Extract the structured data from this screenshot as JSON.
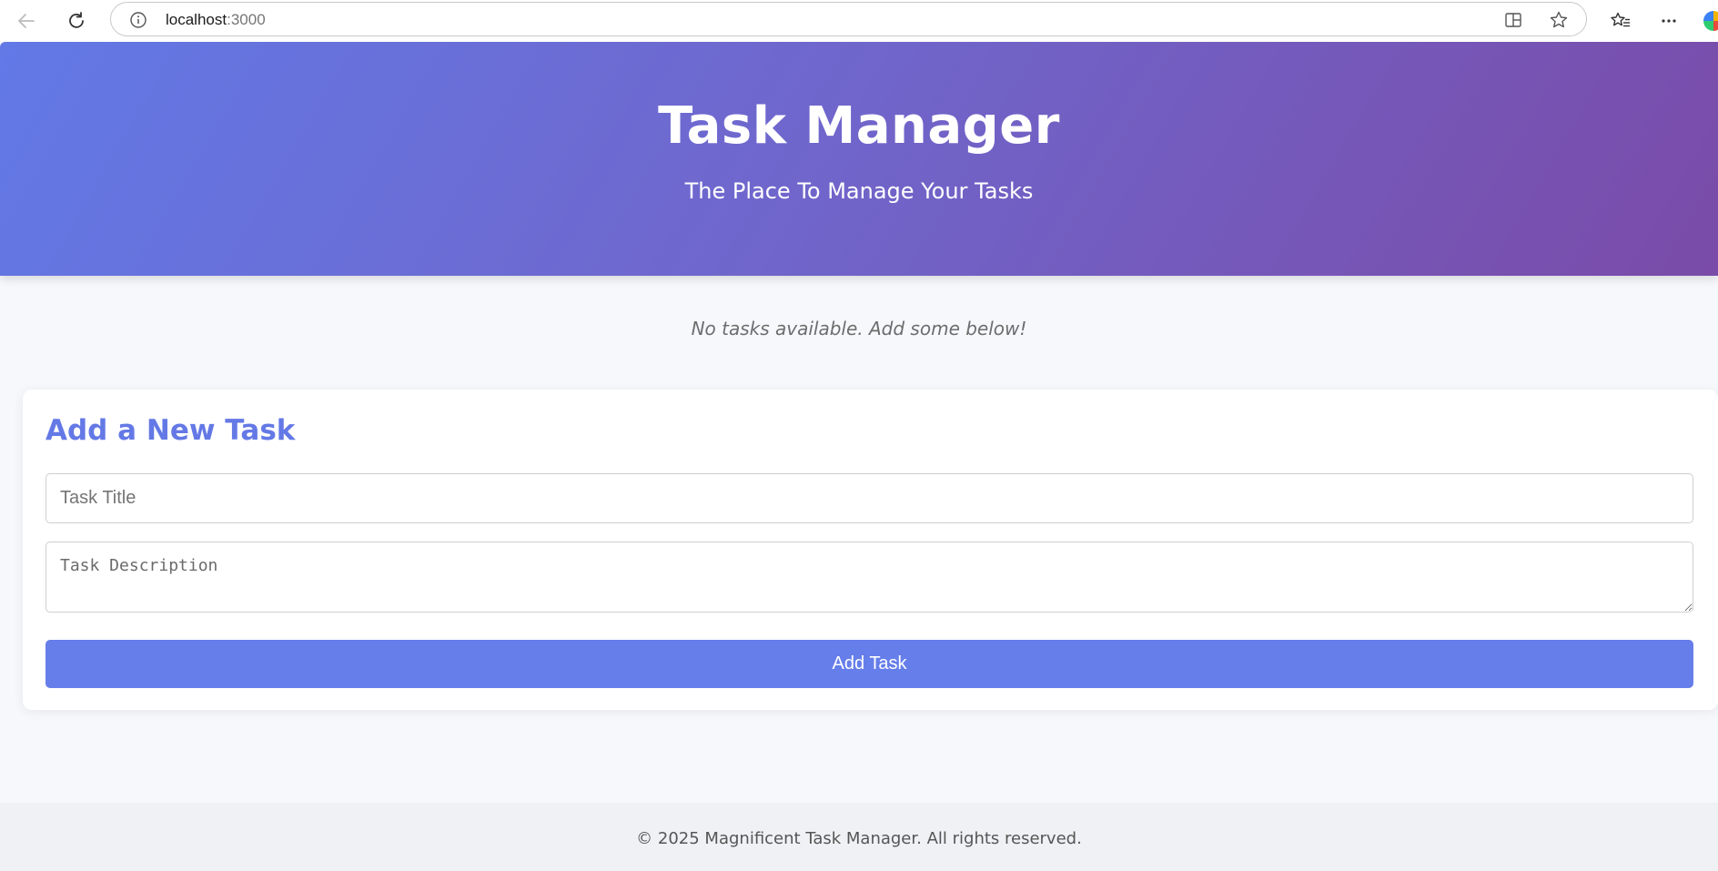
{
  "browser": {
    "url_host": "localhost",
    "url_port": ":3000",
    "icons": [
      "back-arrow-icon",
      "reload-icon",
      "info-icon",
      "split-screen-icon",
      "favorite-star-icon",
      "favorites-list-icon",
      "more-menu-icon"
    ]
  },
  "header": {
    "title": "Task Manager",
    "subtitle": "The Place To Manage Your Tasks"
  },
  "main": {
    "empty_message": "No tasks available. Add some below!"
  },
  "form": {
    "heading": "Add a New Task",
    "title_placeholder": "Task Title",
    "title_value": "",
    "description_placeholder": "Task Description",
    "description_value": "",
    "submit_label": "Add Task"
  },
  "footer": {
    "text": "© 2025 Magnificent Task Manager. All rights reserved."
  },
  "colors": {
    "accent": "#667eea",
    "gradient_start": "#6279e6",
    "gradient_end": "#7a4ba8",
    "page_background": "#f7f8fc"
  }
}
